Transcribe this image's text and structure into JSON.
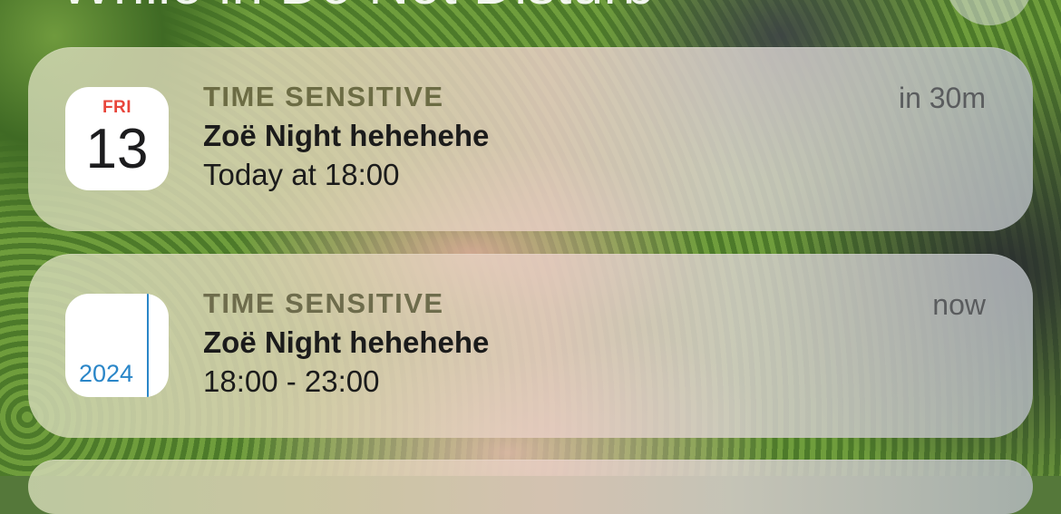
{
  "header": {
    "title": "While in Do Not Disturb"
  },
  "notifications": [
    {
      "icon": "calendar-icon",
      "icon_day": "FRI",
      "icon_date": "13",
      "category": "TIME SENSITIVE",
      "title": "Zoë Night hehehehe",
      "subtitle": "Today at 18:00",
      "time": "in 30m"
    },
    {
      "icon": "calendar-2024-icon",
      "icon_year": "2024",
      "category": "TIME SENSITIVE",
      "title": "Zoë Night hehehehe",
      "subtitle": "18:00 - 23:00",
      "time": "now"
    }
  ],
  "colors": {
    "calendar_red": "#e8453b",
    "calendar_blue": "#2a86c8",
    "category_text": "#6c6c44",
    "time_text": "#5a5c5e"
  }
}
